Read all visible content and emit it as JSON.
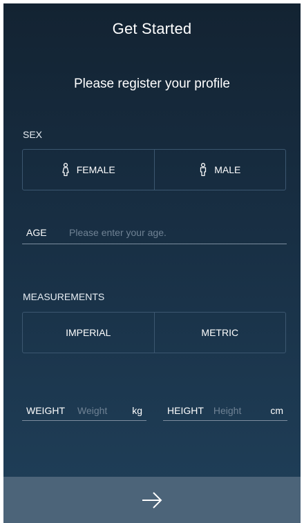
{
  "header": {
    "title": "Get Started",
    "subtitle": "Please register your profile"
  },
  "sex": {
    "label": "SEX",
    "options": [
      {
        "label": "FEMALE",
        "icon": "female-icon"
      },
      {
        "label": "MALE",
        "icon": "male-icon"
      }
    ]
  },
  "age": {
    "label": "AGE",
    "value": "",
    "placeholder": "Please enter your age."
  },
  "measurements": {
    "label": "MEASUREMENTS",
    "options": [
      "IMPERIAL",
      "METRIC"
    ]
  },
  "weight": {
    "label": "WEIGHT",
    "value": "",
    "placeholder": "Weight",
    "unit": "kg"
  },
  "height": {
    "label": "HEIGHT",
    "value": "",
    "placeholder": "Height",
    "unit": "cm"
  },
  "footer": {
    "next_icon": "arrow-right-icon"
  },
  "colors": {
    "background_top": "#132332",
    "background_bottom": "#20405a",
    "button_border": "#3c5770",
    "footer_bar": "#4c6479",
    "placeholder": "#6f8294"
  }
}
